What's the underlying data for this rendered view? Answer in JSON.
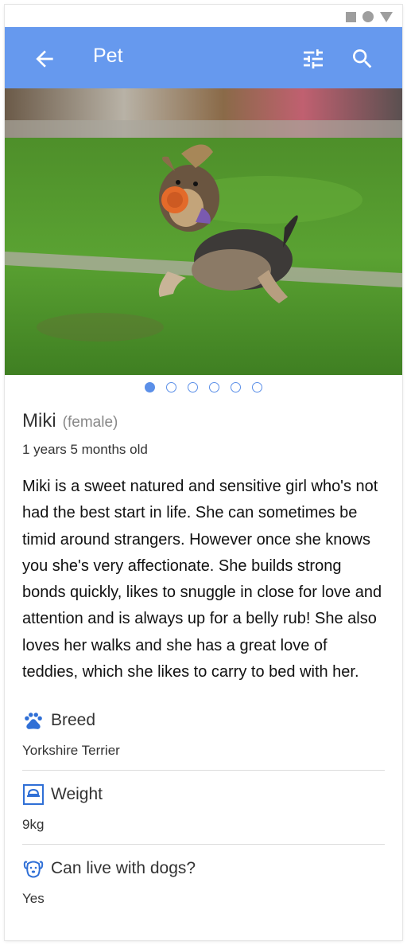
{
  "app_bar": {
    "title": "Pet",
    "color": "#6699ee",
    "icons": [
      "arrow-back-icon",
      "tune-icon",
      "search-icon"
    ]
  },
  "carousel": {
    "dot_count": 6,
    "active_index": 0,
    "accent": "#5b8fe8"
  },
  "pet": {
    "name": "Miki",
    "sex": "(female)",
    "age": "1 years 5 months old",
    "description": "Miki is a sweet natured and sensitive girl who's not had the best start in life. She can sometimes be timid around strangers. However once she knows you she's very affectionate. She builds strong bonds quickly, likes to snuggle in close for love and attention and is always up for a belly rub! She also loves her walks and she has a great love of teddies, which she likes to carry to bed with her."
  },
  "attributes": [
    {
      "icon": "paw-icon",
      "label": "Breed",
      "value": "Yorkshire Terrier"
    },
    {
      "icon": "scale-icon",
      "label": "Weight",
      "value": "9kg"
    },
    {
      "icon": "dog-face-icon",
      "label": "Can live with dogs?",
      "value": "Yes"
    }
  ]
}
